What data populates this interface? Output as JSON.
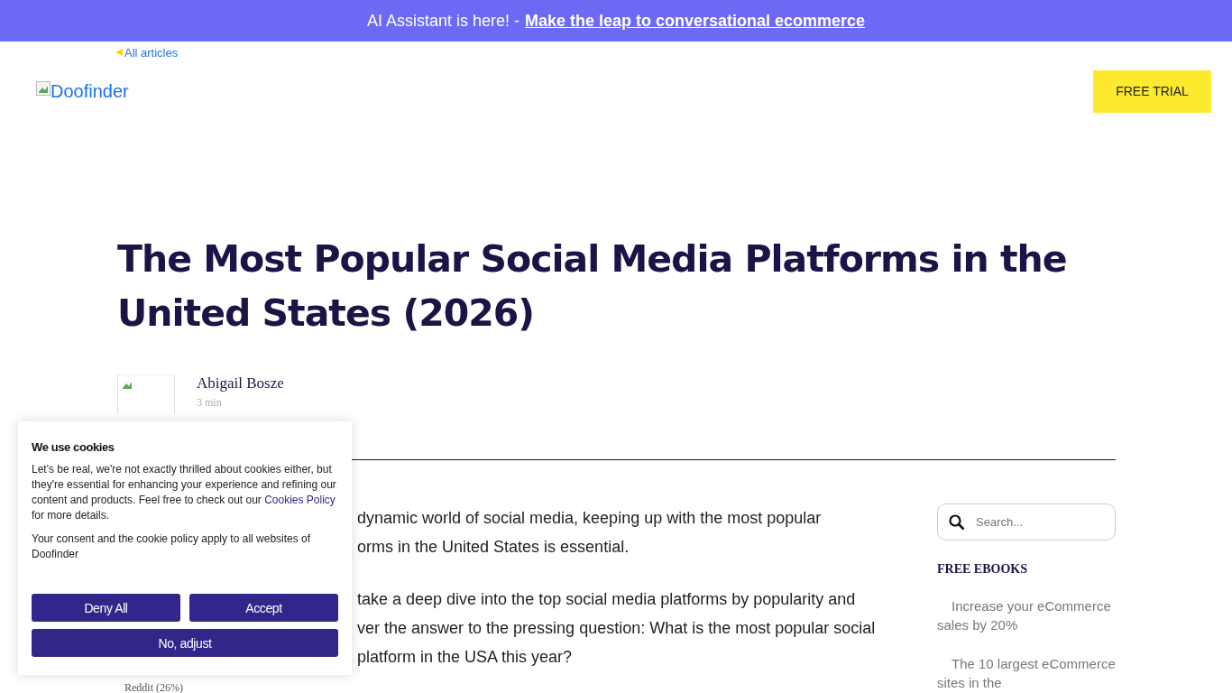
{
  "banner": {
    "text": "AI Assistant is here! -",
    "link": "Make the leap to conversational ecommerce"
  },
  "back_link": "All articles",
  "logo": {
    "alt": "Doofinder"
  },
  "free_trial": "FREE TRIAL",
  "article": {
    "title": "The Most Popular Social Media Platforms in the United States (2026)",
    "author": "Abigail Bosze",
    "read_time": "3 min",
    "paragraphs": [
      [
        "dynamic world of social media, keeping up with the most popular",
        "orms in the United States is essential."
      ],
      [
        "take a deep dive into the top social media platforms by popularity and",
        "ver the answer to the pressing question: What is the most popular social",
        "platform in the USA this year?"
      ]
    ],
    "caption": "Reddit (26%)"
  },
  "sidebar": {
    "search": {
      "placeholder": "Search..."
    },
    "heading": "FREE EBOOKS",
    "ebooks": [
      "Increase your eCommerce sales by 20%",
      "The 10 largest eCommerce sites in the"
    ]
  },
  "cookie_dialog": {
    "title": "We use cookies",
    "text": "Let's be real, we're not exactly thrilled about cookies either, but they're essential for enhancing your experience and refining our content and products. Feel free to check out our",
    "link": "Cookies Policy",
    "text_after": "for more details.",
    "note": "Your consent and the cookie policy apply to all websites of Doofinder",
    "buttons": [
      "Deny All",
      "Accept",
      "No, adjust"
    ]
  }
}
